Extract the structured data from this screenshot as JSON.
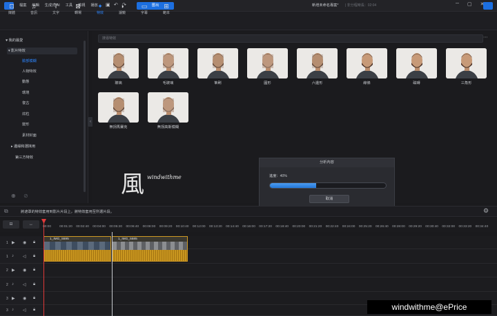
{
  "menu": [
    "檔案",
    "編輯",
    "生成式 AI",
    "工具",
    "檢視",
    "播放"
  ],
  "export_label": "匯出",
  "project": {
    "name": "新增未命名專案*",
    "duration": "| 非分程時長：02:04"
  },
  "toolbar": [
    {
      "label": "媒體",
      "icon": "⊡"
    },
    {
      "label": "音訊",
      "icon": "♫"
    },
    {
      "label": "文字",
      "icon": "T"
    },
    {
      "label": "轉場",
      "icon": "⊠"
    },
    {
      "label": "特效",
      "icon": "✦"
    },
    {
      "label": "濾鏡",
      "icon": "◑"
    },
    {
      "label": "字幕",
      "icon": "▭"
    },
    {
      "label": "範本",
      "icon": "⊞"
    }
  ],
  "sidebar": {
    "favorites": "我的最愛",
    "video_effects": "影片特效",
    "sub": [
      "臉部模糊",
      "人物特效",
      "動態",
      "環境",
      "復古",
      "炫粒",
      "變形",
      "素材封面"
    ],
    "other": [
      "邊緣和選抹用",
      "第三方特效"
    ]
  },
  "search": {
    "placeholder": "搜尋特效"
  },
  "effects": [
    "玻璃",
    "毛玻璃",
    "筆刷",
    "圓形",
    "六邊形",
    "線條",
    "磁磚",
    "三角形",
    "無拐馬賽克",
    "無拐高斯模糊"
  ],
  "dialog": {
    "title": "分析內容",
    "message": "進度：40%",
    "progress": 0.4,
    "cancel": "取消"
  },
  "watermark": {
    "kanji": "風",
    "text": "windwithme",
    "bottom": "windwithme@ePrice"
  },
  "timeline": {
    "tip": "將遮罩的特效套用到影片片段上，將特效套用至所選片段。",
    "ticks": [
      "00:00",
      "00:01:20",
      "00:02:40",
      "00:04:00",
      "00:05:20",
      "00:06:40",
      "00:08:00",
      "00:09:20",
      "00:10:40",
      "00:12:00",
      "00:13:20",
      "00:14:40",
      "00:16:00",
      "00:17:20",
      "00:18:40",
      "00:20:00",
      "00:21:20",
      "00:22:40",
      "00:24:00",
      "00:25:20",
      "00:26:40",
      "00:28:00",
      "00:29:20",
      "00:30:40",
      "00:32:00",
      "00:33:20",
      "00:34:40"
    ],
    "clips": [
      "1_IMG_5595",
      "1_IMG_5585"
    ],
    "tracks": [
      "1",
      "1",
      "2",
      "2",
      "3",
      "3"
    ]
  }
}
